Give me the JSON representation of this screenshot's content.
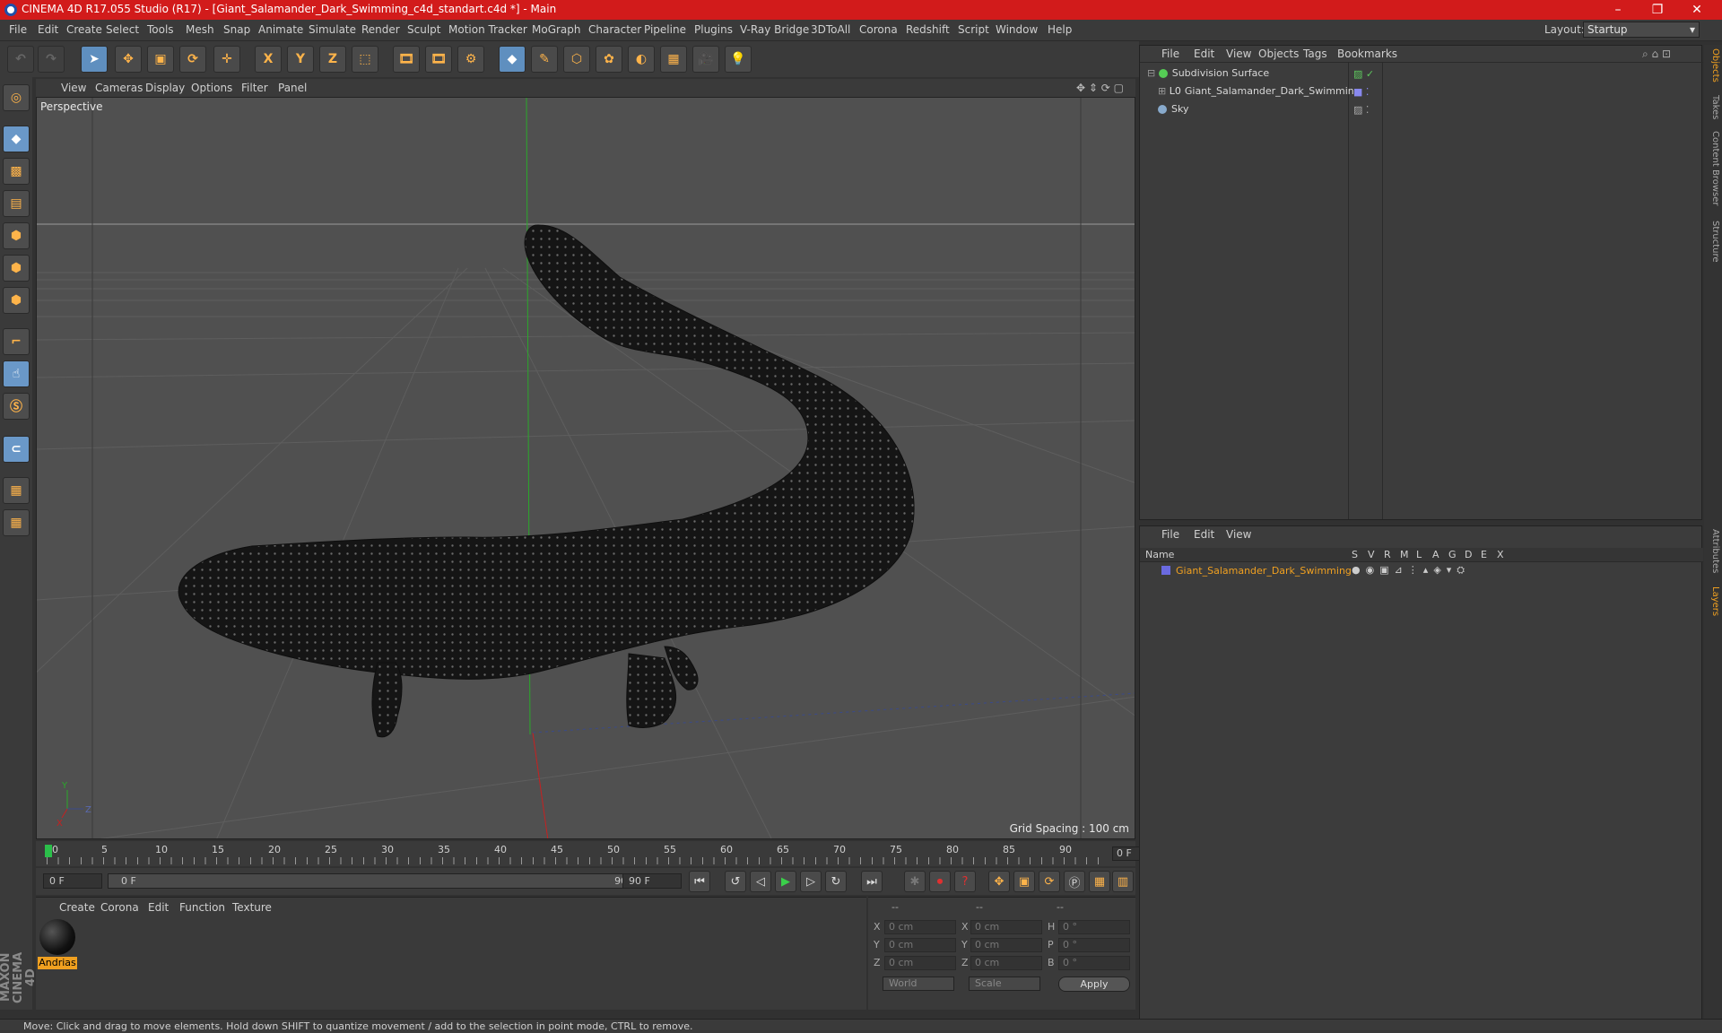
{
  "window": {
    "title": "CINEMA 4D R17.055 Studio (R17) - [Giant_Salamander_Dark_Swimming_c4d_standart.c4d *] - Main",
    "min": "–",
    "max": "❐",
    "close": "✕"
  },
  "menubar": {
    "items": [
      "File",
      "Edit",
      "Create",
      "Select",
      "Tools",
      "Mesh",
      "Snap",
      "Animate",
      "Simulate",
      "Render",
      "Sculpt",
      "Motion Tracker",
      "MoGraph",
      "Character",
      "Pipeline",
      "Plugins",
      "V-Ray Bridge",
      "3DToAll",
      "Corona",
      "Redshift",
      "Script",
      "Window",
      "Help"
    ],
    "layout_label": "Layout:",
    "layout_value": "Startup"
  },
  "toolbar": {
    "x": "X",
    "y": "Y",
    "z": "Z"
  },
  "viewport": {
    "menu": [
      "View",
      "Cameras",
      "Display",
      "Options",
      "Filter",
      "Panel"
    ],
    "label": "Perspective",
    "grid_spacing": "Grid Spacing : 100 cm"
  },
  "timeline": {
    "ticks": [
      "0",
      "5",
      "10",
      "15",
      "20",
      "25",
      "30",
      "35",
      "40",
      "45",
      "50",
      "55",
      "60",
      "65",
      "70",
      "75",
      "80",
      "85",
      "90"
    ],
    "current": "0 F"
  },
  "playback": {
    "start": "0 F",
    "range_start": "0 F",
    "range_end": "90 F",
    "end": "90 F"
  },
  "material": {
    "menu": [
      "Create",
      "Corona",
      "Edit",
      "Function",
      "Texture"
    ],
    "name": "Andrias"
  },
  "coords": {
    "header": [
      "--",
      "--",
      "--"
    ],
    "rows": [
      {
        "l1": "X",
        "v1": "0 cm",
        "l2": "X",
        "v2": "0 cm",
        "l3": "H",
        "v3": "0 °"
      },
      {
        "l1": "Y",
        "v1": "0 cm",
        "l2": "Y",
        "v2": "0 cm",
        "l3": "P",
        "v3": "0 °"
      },
      {
        "l1": "Z",
        "v1": "0 cm",
        "l2": "Z",
        "v2": "0 cm",
        "l3": "B",
        "v3": "0 °"
      }
    ],
    "world": "World",
    "scale": "Scale",
    "apply": "Apply"
  },
  "objects": {
    "menu": [
      "File",
      "Edit",
      "View",
      "Objects",
      "Tags",
      "Bookmarks"
    ],
    "items": [
      {
        "name": "Subdivision Surface",
        "color": "#55cc55"
      },
      {
        "name": "Giant_Salamander_Dark_Swimming",
        "color": "#aaaaaa"
      },
      {
        "name": "Sky",
        "color": "#88aacc"
      }
    ]
  },
  "layers": {
    "menu": [
      "File",
      "Edit",
      "View"
    ],
    "columns": [
      "Name",
      "S",
      "V",
      "R",
      "M",
      "L",
      "A",
      "G",
      "D",
      "E",
      "X"
    ],
    "row_name": "Giant_Salamander_Dark_Swimming"
  },
  "right_tabs": [
    "Objects",
    "Takes",
    "Content Browser",
    "Structure",
    "Attributes",
    "Layers"
  ],
  "status": "Move: Click and drag to move elements. Hold down SHIFT to quantize movement / add to the selection in point mode, CTRL to remove.",
  "brand": "MAXON CINEMA 4D",
  "colors": {
    "accent": "#d21b1b",
    "selection": "#f0a020",
    "axis_x": "#cc2222",
    "axis_y": "#22aa22"
  }
}
